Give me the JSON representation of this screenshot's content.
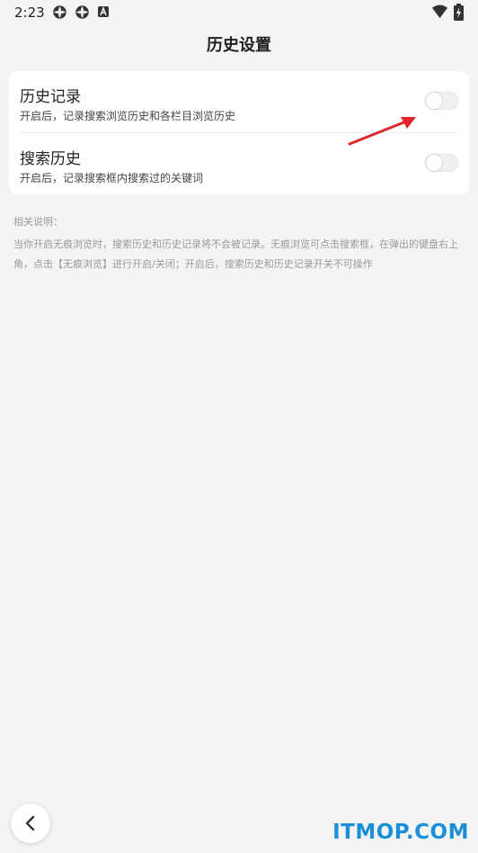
{
  "status_bar": {
    "time": "2:23",
    "icons": [
      "settings-gear-icon",
      "settings-gear-icon",
      "notification-a-icon",
      "wifi-icon",
      "battery-icon"
    ]
  },
  "page": {
    "title": "历史设置"
  },
  "settings": [
    {
      "title": "历史记录",
      "description": "开启后，记录搜索浏览历史和各栏目浏览历史",
      "enabled": false
    },
    {
      "title": "搜索历史",
      "description": "开启后，记录搜索框内搜索过的关键词",
      "enabled": false
    }
  ],
  "notes": {
    "title": "相关说明：",
    "body": "当你开启无痕浏览时，搜索历史和历史记录将不会被记录。无痕浏览可点击搜索框，在弹出的键盘右上角，点击【无痕浏览】进行开启/关闭；开启后，搜索历史和历史记录开关不可操作"
  },
  "watermark": "ITMOP.COM",
  "colors": {
    "background": "#f4f4f4",
    "card": "#ffffff",
    "annotation_arrow": "#e0262c",
    "watermark": "#1a8fd8"
  }
}
